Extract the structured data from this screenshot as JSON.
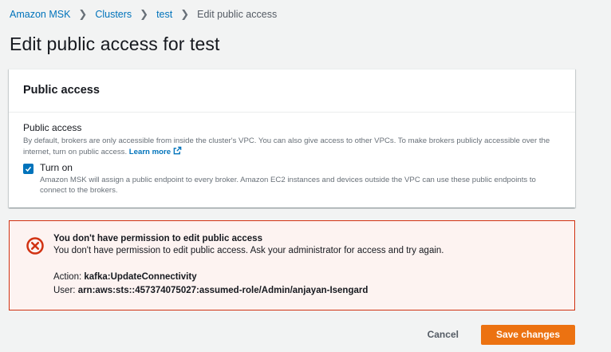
{
  "breadcrumb": {
    "items": [
      "Amazon MSK",
      "Clusters",
      "test"
    ],
    "current": "Edit public access"
  },
  "page": {
    "title": "Edit public access for test"
  },
  "panel": {
    "title": "Public access",
    "field_label": "Public access",
    "field_desc": "By default, brokers are only accessible from inside the cluster's VPC. You can also give access to other VPCs. To make brokers publicly accessible over the internet, turn on public access.",
    "learn_more": "Learn more",
    "checkbox_label": "Turn on",
    "checkbox_checked": true,
    "checkbox_desc": "Amazon MSK will assign a public endpoint to every broker. Amazon EC2 instances and devices outside the VPC can use these public endpoints to connect to the brokers."
  },
  "alert": {
    "title": "You don't have permission to edit public access",
    "message": "You don't have permission to edit public access. Ask your administrator for access and try again.",
    "action_label": "Action:",
    "action_value": "kafka:UpdateConnectivity",
    "user_label": "User:",
    "user_value": "arn:aws:sts::457374075027:assumed-role/Admin/anjayan-Isengard"
  },
  "actions": {
    "cancel_label": "Cancel",
    "save_label": "Save changes"
  },
  "icons": {
    "alert": "error-circle-icon",
    "external": "external-link-icon",
    "check": "checkmark-icon",
    "separator": "chevron-right-icon"
  },
  "colors": {
    "link": "#0073bb",
    "primary": "#ec7211",
    "error": "#d13212",
    "error_bg": "#fdf3f1"
  }
}
